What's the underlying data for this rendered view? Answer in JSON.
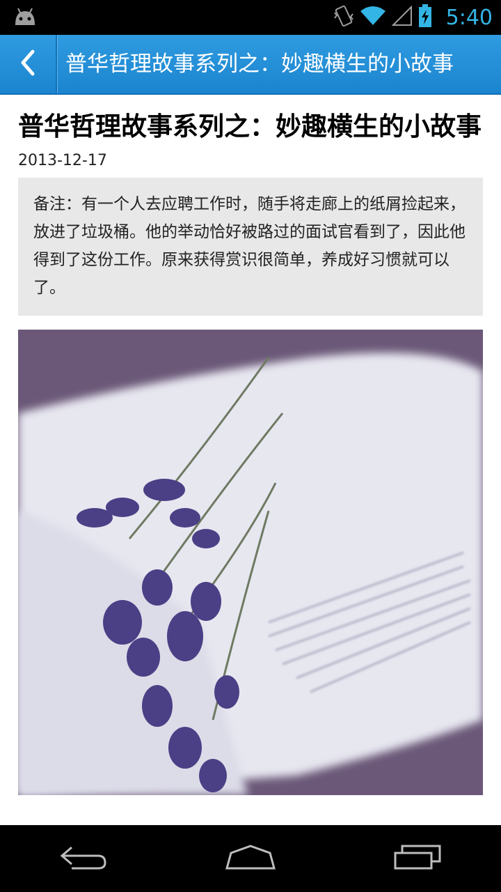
{
  "status_bar": {
    "time": "5:40",
    "icons": [
      "android-icon",
      "vibrate-icon",
      "wifi-icon",
      "signal-icon",
      "battery-charging-icon"
    ]
  },
  "action_bar": {
    "back_icon": "chevron-left-icon",
    "title": "普华哲理故事系列之：妙趣横生的小故事"
  },
  "article": {
    "title": "普华哲理故事系列之：妙趣横生的小故事",
    "date": "2013-12-17",
    "note": "备注：有一个人去应聘工作时，随手将走廊上的纸屑捡起来，放进了垃圾桶。他的举动恰好被路过的面试官看到了，因此他得到了这份工作。原来获得赏识很简单，养成好习惯就可以了。",
    "image": "open-book-lavender-photo"
  },
  "nav_bar": {
    "buttons": [
      "back-icon",
      "home-icon",
      "recent-apps-icon"
    ]
  },
  "colors": {
    "accent": "#33b5e5",
    "action_bar": "#1f8ad4",
    "note_bg": "#e8e8e8"
  }
}
